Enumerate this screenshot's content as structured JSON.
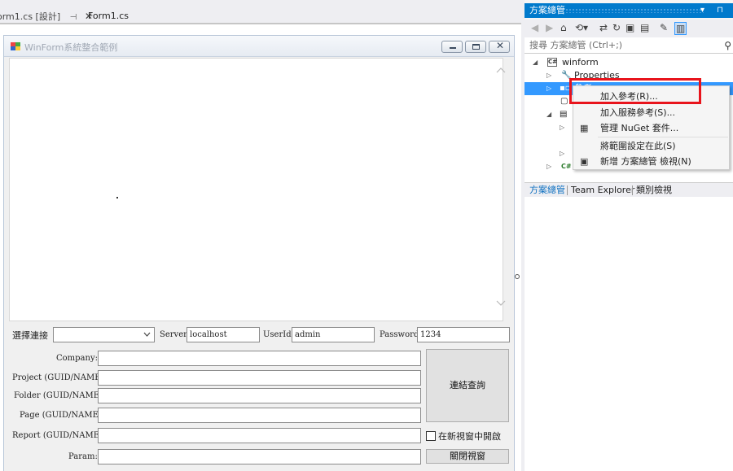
{
  "doc_tabs": {
    "tab1_label": "orm1.cs [設計]",
    "tab1_pin": "⊣",
    "tab1_close": "✕",
    "tab2_label": "Form1.cs"
  },
  "form": {
    "title": "WinForm系統整合範例",
    "minimize": "",
    "maximize": "",
    "close": "✕",
    "labels": {
      "select_connection": "選擇連接",
      "server": "Server",
      "userid": "UserId",
      "password": "Password",
      "company": "Company:",
      "project": "Project (GUID/NAME):",
      "folder": "Folder (GUID/NAME):",
      "page": "Page (GUID/NAME):",
      "report": "Report (GUID/NAME):",
      "param": "Param:"
    },
    "values": {
      "server": "localhost",
      "userid": "admin",
      "password": "1234"
    },
    "buttons": {
      "connect_query": "連結查詢",
      "close_window": "關閉視窗"
    },
    "checkbox_label": "在新視窗中開啟"
  },
  "solution_explorer": {
    "title": "方案總管",
    "header_icons": "▾ ⊓",
    "search_placeholder": "搜尋 方案總管 (Ctrl+;)",
    "tree": {
      "solution": "winform",
      "properties": "Properties",
      "references": "參考"
    },
    "tabs": [
      "方案總管",
      "Team Explorer",
      "類別檢視"
    ]
  },
  "context_menu": {
    "items": [
      "加入參考(R)...",
      "加入服務參考(S)...",
      "管理 NuGet 套件...",
      "將範圍設定在此(S)",
      "新增 方案總管 檢視(N)"
    ]
  },
  "colors": {
    "accent": "#007acc",
    "selection": "#3399ff",
    "highlight_box": "#e8141c"
  }
}
